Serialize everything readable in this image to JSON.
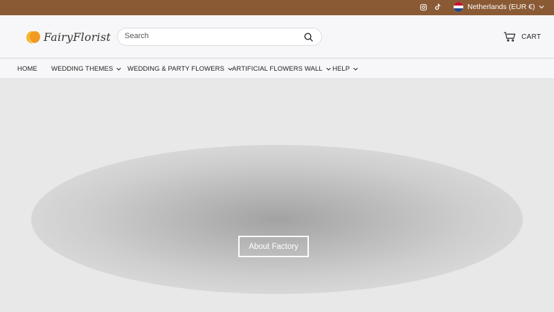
{
  "colors": {
    "topbar": "#8a5a35",
    "header_bg": "#f7f7f9",
    "hero_bg": "#e8e8e8",
    "logo_orange": "#f2a02c"
  },
  "topbar": {
    "social_icons": [
      "instagram-icon",
      "tiktok-icon"
    ],
    "locale_label": "Netherlands (EUR €)"
  },
  "header": {
    "logo_text": "FairyFlorist",
    "search": {
      "placeholder": "Search"
    },
    "cart_label": "CART"
  },
  "nav": {
    "items": [
      {
        "label": "HOME",
        "has_dropdown": false
      },
      {
        "label": "WEDDING THEMES",
        "has_dropdown": true
      },
      {
        "label": "WEDDING & PARTY FLOWERS",
        "has_dropdown": true
      },
      {
        "label": "ARTIFICIAL FLOWERS WALL",
        "has_dropdown": true
      },
      {
        "label": "HELP",
        "has_dropdown": true
      }
    ]
  },
  "hero": {
    "cta_label": "About Factory"
  }
}
